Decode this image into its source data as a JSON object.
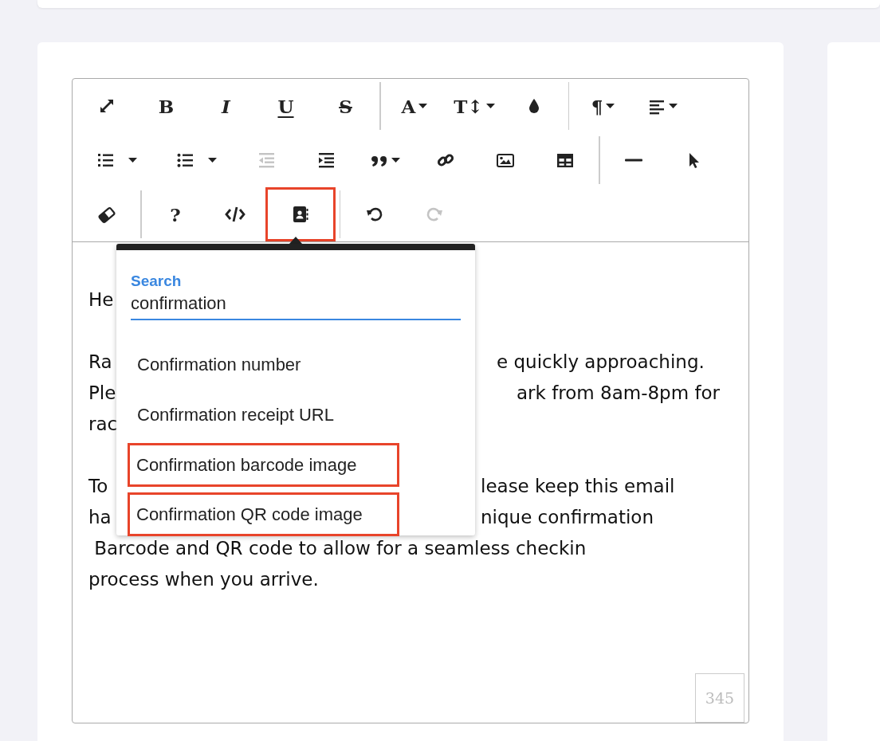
{
  "toolbar": {
    "rows": [
      {
        "groups": [
          {
            "buttons": [
              {
                "kind": "expand",
                "disabled": false,
                "highlighted": false,
                "caret": false
              },
              {
                "kind": "bold",
                "label": "B",
                "disabled": false,
                "highlighted": false,
                "caret": false
              },
              {
                "kind": "italic",
                "label": "I",
                "disabled": false,
                "highlighted": false,
                "caret": false
              },
              {
                "kind": "underline",
                "label": "U",
                "disabled": false,
                "highlighted": false,
                "caret": false
              },
              {
                "kind": "strike",
                "label": "S",
                "disabled": false,
                "highlighted": false,
                "caret": false
              }
            ]
          },
          {
            "buttons": [
              {
                "kind": "glyph",
                "label": "A",
                "disabled": false,
                "highlighted": false,
                "caret": true
              },
              {
                "kind": "glyph",
                "label": "T↕",
                "disabled": false,
                "highlighted": false,
                "caret": true
              },
              {
                "kind": "drop",
                "disabled": false,
                "highlighted": false,
                "caret": false
              }
            ]
          },
          {
            "buttons": [
              {
                "kind": "glyph",
                "label": "¶",
                "disabled": false,
                "highlighted": false,
                "caret": true
              },
              {
                "kind": "align",
                "disabled": false,
                "highlighted": false,
                "caret": true
              }
            ]
          }
        ]
      },
      {
        "groups": [
          {
            "buttons": [
              {
                "kind": "ol",
                "disabled": false,
                "highlighted": false,
                "caret": true
              },
              {
                "kind": "ul",
                "disabled": false,
                "highlighted": false,
                "caret": true
              },
              {
                "kind": "outdent",
                "disabled": true,
                "highlighted": false,
                "caret": false
              },
              {
                "kind": "indent",
                "disabled": false,
                "highlighted": false,
                "caret": false
              },
              {
                "kind": "quote",
                "disabled": false,
                "highlighted": false,
                "caret": true
              },
              {
                "kind": "link",
                "disabled": false,
                "highlighted": false,
                "caret": false
              },
              {
                "kind": "image",
                "disabled": false,
                "highlighted": false,
                "caret": false
              },
              {
                "kind": "table",
                "disabled": false,
                "highlighted": false,
                "caret": false
              }
            ]
          },
          {
            "buttons": [
              {
                "kind": "hr",
                "disabled": false,
                "highlighted": false,
                "caret": false
              },
              {
                "kind": "pointer",
                "disabled": false,
                "highlighted": false,
                "caret": false
              }
            ]
          }
        ]
      },
      {
        "groups": [
          {
            "buttons": [
              {
                "kind": "eraser",
                "disabled": false,
                "highlighted": false,
                "caret": false
              }
            ]
          },
          {
            "buttons": [
              {
                "kind": "glyph",
                "label": "?",
                "disabled": false,
                "highlighted": false,
                "caret": false
              },
              {
                "kind": "code",
                "disabled": false,
                "highlighted": false,
                "caret": false
              },
              {
                "kind": "contact",
                "disabled": false,
                "highlighted": true,
                "caret": false
              }
            ]
          },
          {
            "buttons": [
              {
                "kind": "undo",
                "disabled": false,
                "highlighted": false,
                "caret": false
              },
              {
                "kind": "redo",
                "disabled": true,
                "highlighted": false,
                "caret": false
              }
            ]
          }
        ]
      }
    ]
  },
  "content": {
    "paragraphs": [
      {
        "lines": [
          {
            "left": "He"
          }
        ]
      },
      {
        "lines": [
          {
            "left": "Ra",
            "right": "e quickly approaching."
          },
          {
            "left": "Ple",
            "right": "ark from 8am-8pm for"
          },
          {
            "left": "rac"
          }
        ]
      },
      {
        "lines": [
          {
            "left": "To",
            "right": "lease keep this email"
          },
          {
            "left": "ha",
            "right": "nique confirmation"
          },
          {
            "left": " Barcode and QR code to allow for a seamless checkin"
          },
          {
            "left": "process when you arrive."
          }
        ]
      }
    ]
  },
  "menu": {
    "search_label": "Search",
    "search_value": "confirmation",
    "items": [
      {
        "label": "Confirmation number",
        "highlighted": false
      },
      {
        "label": "Confirmation receipt URL",
        "highlighted": false
      },
      {
        "label": "Confirmation barcode image",
        "highlighted": true
      },
      {
        "label": "Confirmation QR code image",
        "highlighted": true
      }
    ]
  },
  "counter": "345"
}
